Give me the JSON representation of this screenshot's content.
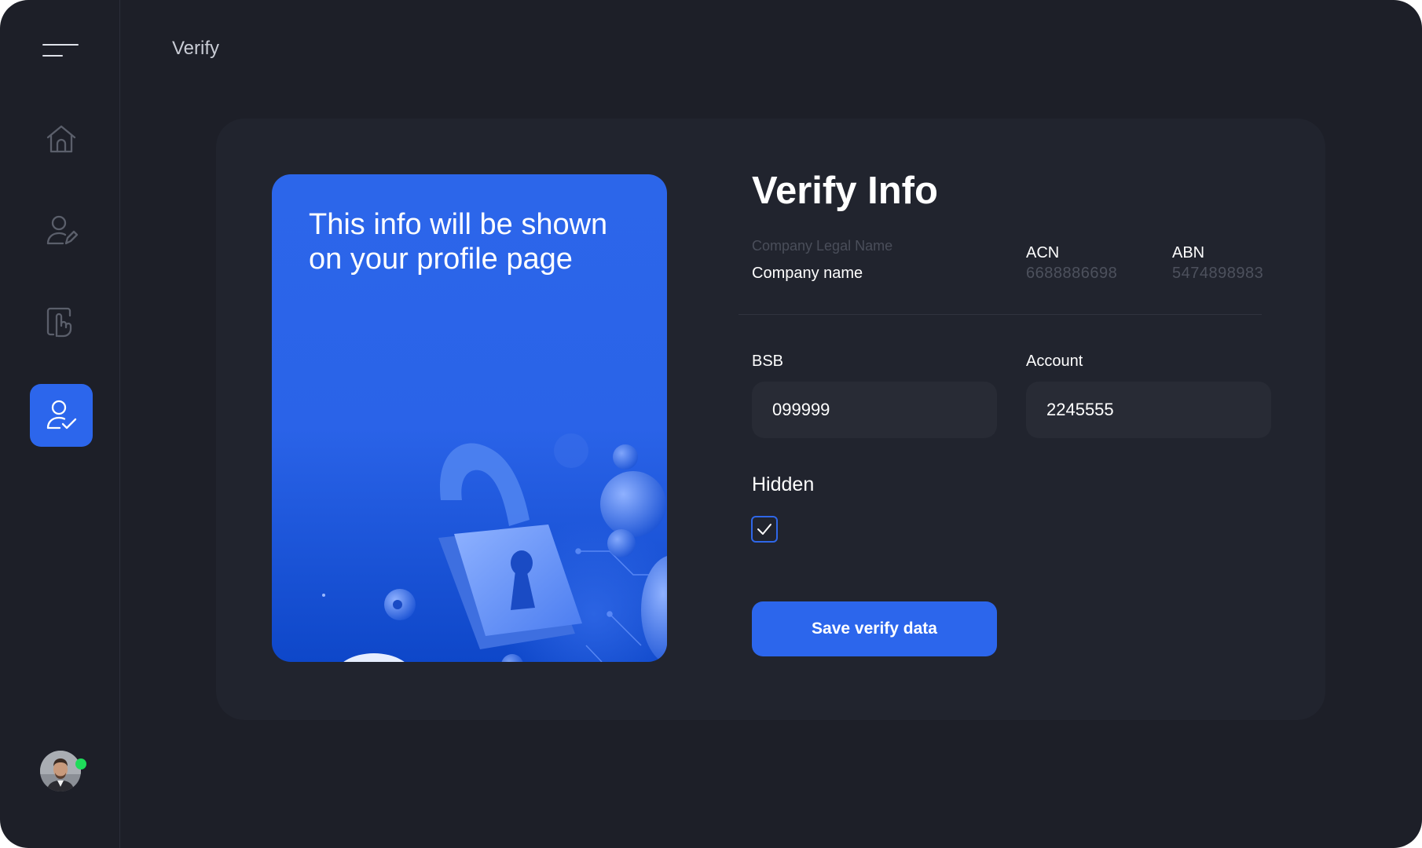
{
  "header": {
    "title": "Verify"
  },
  "sidebar": {
    "items": [
      {
        "id": "home",
        "icon": "home-icon",
        "active": false
      },
      {
        "id": "profile",
        "icon": "user-edit-icon",
        "active": false
      },
      {
        "id": "touch",
        "icon": "touch-icon",
        "active": false
      },
      {
        "id": "verify",
        "icon": "user-check-icon",
        "active": true
      }
    ],
    "user": {
      "online": true,
      "status_color": "#1fdb5a"
    }
  },
  "promo": {
    "text": "This info will be shown on your profile page"
  },
  "verify": {
    "title": "Verify Info",
    "company_legal_name_label": "Company Legal Name",
    "company_name": "Company name",
    "acn_label": "ACN",
    "acn_value": "6688886698",
    "abn_label": "ABN",
    "abn_value": "5474898983",
    "bsb_label": "BSB",
    "bsb_value": "099999",
    "account_label": "Account",
    "account_value": "2245555",
    "hidden_label": "Hidden",
    "hidden_checked": true,
    "save_label": "Save verify data"
  },
  "colors": {
    "accent": "#2c66ec",
    "background": "#1d1f28",
    "panel": "#21242e",
    "input": "#282b35"
  }
}
